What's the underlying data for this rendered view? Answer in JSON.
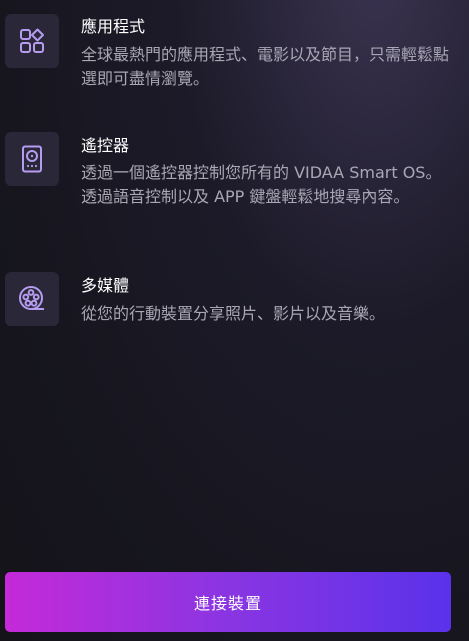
{
  "features": [
    {
      "icon": "apps-grid-icon",
      "title": "應用程式",
      "description": "全球最熱門的應用程式、電影以及節目，只需輕鬆點選即可盡情瀏覽。"
    },
    {
      "icon": "remote-control-icon",
      "title": "遙控器",
      "description": "透過一個遙控器控制您所有的 VIDAA Smart OS。透過語音控制以及 APP 鍵盤輕鬆地搜尋內容。"
    },
    {
      "icon": "film-reel-icon",
      "title": "多媒體",
      "description": "從您的行動裝置分享照片、影片以及音樂。"
    }
  ],
  "colors": {
    "icon_stroke": "#b59cf0",
    "button_gradient_start": "#c42ad8",
    "button_gradient_end": "#5a32ea"
  },
  "connect_button": {
    "label": "連接裝置"
  }
}
